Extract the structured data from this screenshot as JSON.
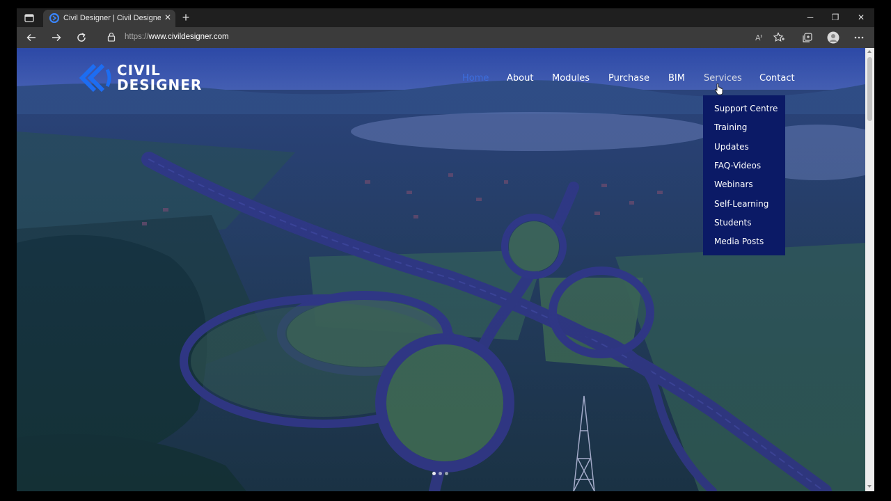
{
  "browser": {
    "tab": {
      "title": "Civil Designer | Civil Designer civil engineering software"
    },
    "address_bar": {
      "scheme": "https://",
      "host": "www.civildesigner.com"
    },
    "icons": {
      "tab_actions": "tab-actions-icon",
      "favicon": "civil-designer-favicon",
      "close_tab": "close-icon",
      "new_tab": "plus-icon",
      "back": "back-arrow-icon",
      "forward": "forward-arrow-icon",
      "refresh": "refresh-icon",
      "lock": "lock-icon",
      "read_aloud": "read-aloud-icon",
      "favorites": "star-add-icon",
      "collections": "collections-icon",
      "profile": "profile-avatar-icon",
      "menu": "more-dots-icon",
      "minimize": "minimize-icon",
      "maximize": "maximize-icon",
      "close_window": "close-window-icon"
    },
    "window_controls": {
      "minimize": "─",
      "maximize": "❐",
      "close": "✕"
    },
    "tab_close_glyph": "✕",
    "new_tab_glyph": "+"
  },
  "site": {
    "logo": {
      "line1": "CIVIL",
      "line2": "DESIGNER"
    },
    "nav": [
      {
        "label": "Home",
        "state": "active"
      },
      {
        "label": "About",
        "state": "normal"
      },
      {
        "label": "Modules",
        "state": "normal"
      },
      {
        "label": "Purchase",
        "state": "normal"
      },
      {
        "label": "BIM",
        "state": "normal"
      },
      {
        "label": "Services",
        "state": "hover"
      },
      {
        "label": "Contact",
        "state": "normal"
      }
    ],
    "services_menu": [
      "Support Centre",
      "Training",
      "Updates",
      "FAQ-Videos",
      "Webinars",
      "Self-Learning",
      "Students",
      "Media Posts"
    ],
    "slider": {
      "slide_count": 3,
      "active_slide": 1
    },
    "colors": {
      "accent_active": "#3d6ddc",
      "dropdown_bg": "#0b1a66",
      "logo_blue": "#1d6df2"
    }
  }
}
